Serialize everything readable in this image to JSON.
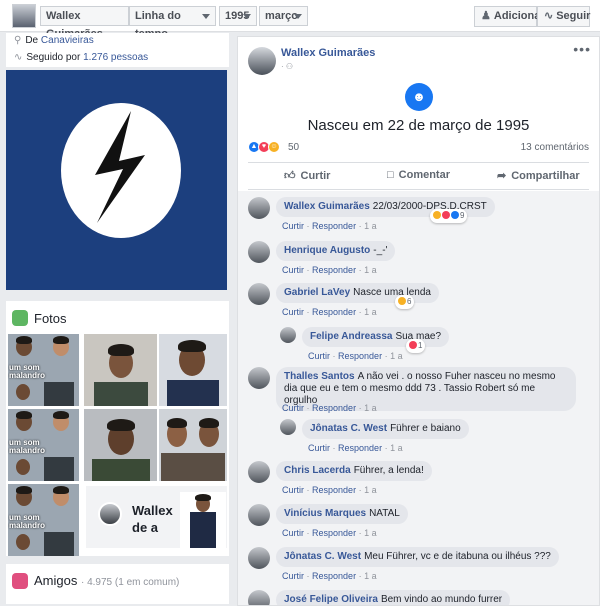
{
  "topbar": {
    "name": "Wallex Guimarães",
    "crumbs": [
      "Linha do tempo",
      "1995",
      "março"
    ],
    "add_label": "Adicionar",
    "follow_label": "Seguir"
  },
  "about": {
    "from_prefix": "De",
    "from_place": "Canavieiras",
    "followed_prefix": "Seguido por",
    "followed_count": "1.276 pessoas"
  },
  "photos": {
    "title": "Fotos",
    "caption_1": "um som",
    "caption_2": "malandro",
    "card_name": "Wallex",
    "card_sub": "de a"
  },
  "friends": {
    "title": "Amigos",
    "count": "· 4.975 (1 em comum)"
  },
  "post": {
    "author": "Wallex Guimarães",
    "meta": "· ⚇",
    "event_title": "Nasceu em 22 de março de 1995",
    "reaction_count": "50",
    "comments_count": "13 comentários",
    "actions": {
      "like": "Curtir",
      "comment": "Comentar",
      "share": "Compartilhar"
    }
  },
  "comment_links": {
    "like": "Curtir",
    "reply": "Responder",
    "sep": "·",
    "time": "1 a"
  },
  "comments": [
    {
      "name": "Wallex Guimarães",
      "text": "22/03/2000-DPS.D.CRST",
      "reactions": "9"
    },
    {
      "name": "Henrique Augusto",
      "text": "-_-'"
    },
    {
      "name": "Gabriel LaVey",
      "text": "Nasce uma lenda",
      "reactions": "6"
    },
    {
      "name": "Felipe Andreassa",
      "text": "Sua mae?",
      "reactions": "1"
    },
    {
      "name": "Thalles Santos",
      "text": "A não vei . o nosso Fuher nasceu no mesmo dia que eu e tem o mesmo ddd 73 . Tassio Robert só me orgulho"
    },
    {
      "name": "Jônatas C. West",
      "text": "Führer e baiano"
    },
    {
      "name": "Chris Lacerda",
      "text": "Führer, a lenda!"
    },
    {
      "name": "Vinícius Marques",
      "text": "NATAL"
    },
    {
      "name": "Jônatas C. West",
      "text": "Meu Führer, vc e de itabuna ou ilhéus ???"
    },
    {
      "name": "José Felipe Oliveira",
      "text": "Bem vindo ao mundo furrer"
    }
  ],
  "colors": {
    "fb_blue": "#385898",
    "cover_bg": "#1c3f7e",
    "like": "#1877f2",
    "love": "#f33e58",
    "haha": "#f7b125"
  }
}
